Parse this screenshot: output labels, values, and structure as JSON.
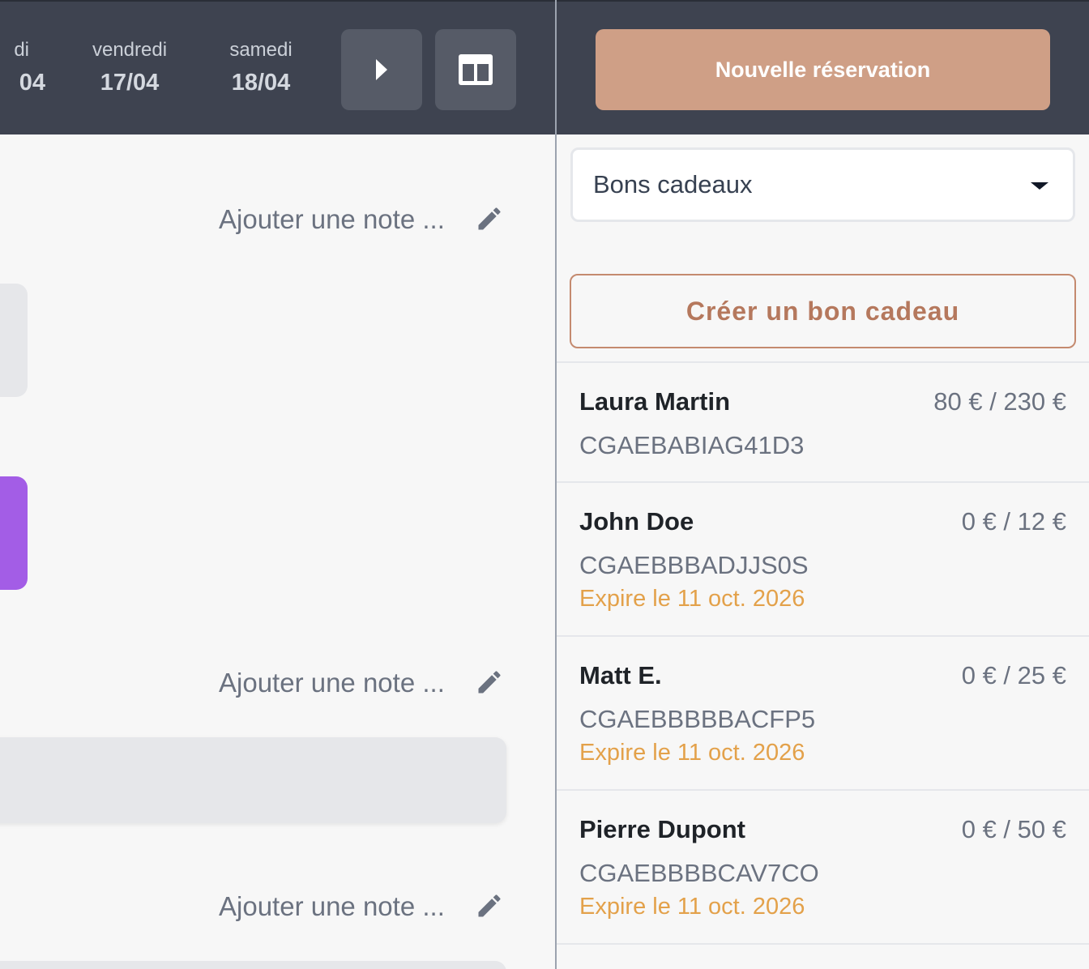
{
  "calendar": {
    "days": [
      {
        "name": "di",
        "date": "04"
      },
      {
        "name": "vendredi",
        "date": "17/04"
      },
      {
        "name": "samedi",
        "date": "18/04"
      }
    ],
    "next_icon": "play-triangle-icon",
    "layout_icon": "split-view-icon",
    "note_placeholder": "Ajouter une note ...",
    "event_colors": {
      "grey": "#e6e7ea",
      "purple": "#a35de6"
    }
  },
  "sidebar": {
    "new_booking_label": "Nouvelle réservation",
    "filter": {
      "selected": "Bons cadeaux"
    },
    "create_voucher_label": "Créer un bon cadeau",
    "vouchers": [
      {
        "name": "Laura Martin",
        "amount": "80 € / 230 €",
        "code": "CGAEBABIAG41D3",
        "expiry": ""
      },
      {
        "name": "John Doe",
        "amount": "0 € / 12 €",
        "code": "CGAEBBBADJJS0S",
        "expiry": "Expire le 11 oct. 2026"
      },
      {
        "name": "Matt E.",
        "amount": "0 € / 25 €",
        "code": "CGAEBBBBBACFP5",
        "expiry": "Expire le 11 oct. 2026"
      },
      {
        "name": "Pierre Dupont",
        "amount": "0 € / 50 €",
        "code": "CGAEBBBBCAV7CO",
        "expiry": "Expire le 11 oct. 2026"
      }
    ]
  },
  "colors": {
    "topbar": "#3e4350",
    "accent": "#cf9f86",
    "accent_text": "#b5785d",
    "expiry": "#e3a14a"
  }
}
